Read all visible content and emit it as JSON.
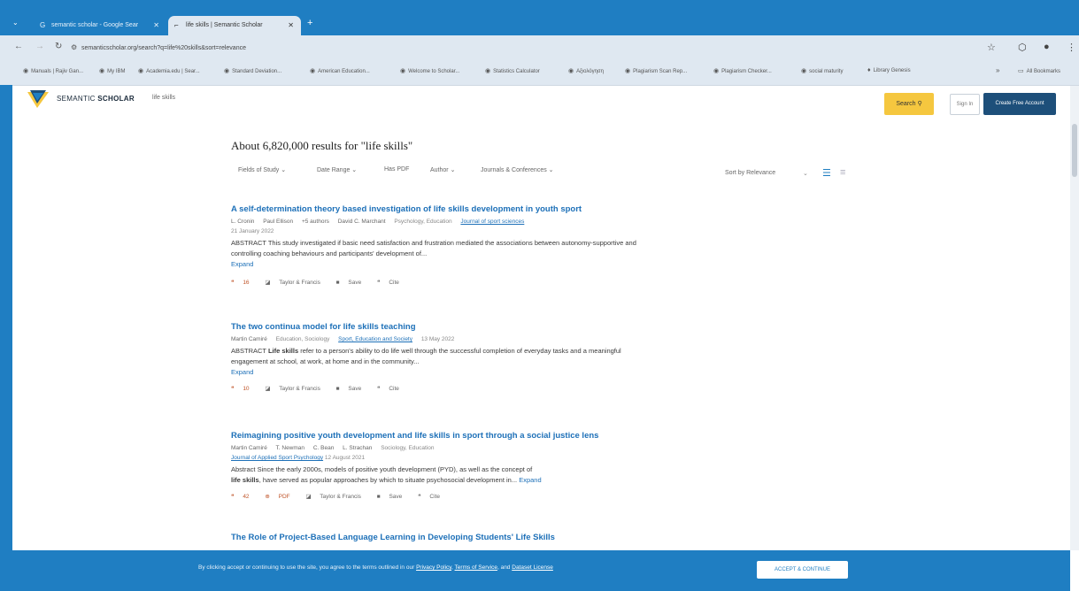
{
  "tabs": [
    {
      "label": "semantic scholar - Google Sear",
      "active": false
    },
    {
      "label": "life skills | Semantic Scholar",
      "active": true
    }
  ],
  "address": {
    "url": "semanticscholar.org/search?q=life%20skills&sort=relevance"
  },
  "bookmarks": [
    "Manuals | Rajiv Gan...",
    "My IBM",
    "Academia.edu | Sear...",
    "Standard Deviation...",
    "American Education...",
    "Welcome to Scholar...",
    "Statistics Calculator",
    "Αξιολόγηση",
    "Plagiarism Scan Rep...",
    "Plagiarism Checker...",
    "social maturity",
    "Library Genesis"
  ],
  "bookmarks_more": "»",
  "bookmarks_all": "All Bookmarks",
  "header": {
    "logo_light": "SEMANTIC",
    "logo_bold": "SCHOLAR",
    "query": "life skills",
    "search_label": "Search",
    "signin_label": "Sign In",
    "create_label": "Create Free Account"
  },
  "results_header": {
    "count_text": "About 6,820,000 results for \"life skills\"",
    "filters": [
      "Fields of Study ⌄",
      "Date Range ⌄",
      "Has PDF",
      "Author ⌄",
      "Journals & Conferences ⌄"
    ],
    "sort_label": "Sort by Relevance",
    "sort_chevron": "⌄"
  },
  "results": [
    {
      "title": "A self-determination theory based investigation of life skills development in youth sport",
      "authors": [
        "L. Cronin",
        "Paul Ellison",
        "+5 authors",
        "David C. Marchant"
      ],
      "fields": "Psychology, Education",
      "journal": "Journal of sport sciences",
      "date": "21 January 2022",
      "abstract_lead": "ABSTRACT",
      "abstract": "This study investigated if basic need satisfaction and frustration mediated the associations between autonomy-supportive and controlling coaching behaviours and participants' development of...",
      "expand": "Expand",
      "citations": "16",
      "publisher": "Taylor & Francis",
      "save": "Save",
      "cite": "Cite"
    },
    {
      "title": "The two continua model for life skills teaching",
      "authors": [
        "Martin Camiré"
      ],
      "fields": "Education, Sociology",
      "journal": "Sport, Education and Society",
      "date": "13 May 2022",
      "abstract_lead": "ABSTRACT",
      "abstract_bold": "Life skills",
      "abstract": "refer to a person's ability to do life well through the successful completion of everyday tasks and a meaningful engagement at school, at work, at home and in the community...",
      "expand": "Expand",
      "citations": "10",
      "publisher": "Taylor & Francis",
      "save": "Save",
      "cite": "Cite"
    },
    {
      "title": "Reimagining positive youth development and life skills in sport through a social justice lens",
      "authors": [
        "Martin Camiré",
        "T. Newman",
        "C. Bean",
        "L. Strachan"
      ],
      "fields": "Sociology, Education",
      "journal": "Journal of Applied Sport Psychology",
      "date": "12 August 2021",
      "abstract_lead": "Abstract",
      "abstract": "Since the early 2000s, models of positive youth development (PYD), as well as the concept of",
      "abstract_bold2": "life skills",
      "abstract2": ", have served as popular approaches by which to situate psychosocial development in...",
      "expand": "Expand",
      "citations": "42",
      "pdf": "PDF",
      "publisher": "Taylor & Francis",
      "save": "Save",
      "cite": "Cite"
    },
    {
      "title": "The Role of Project-Based Language Learning in Developing Students' Life Skills"
    }
  ],
  "cookie": {
    "text": "By clicking accept or continuing to use the site, you agree to the terms outlined in our",
    "privacy": "Privacy Policy",
    "tos": "Terms of Service",
    "and": "and",
    "dataset": "Dataset License",
    "accept_label": "ACCEPT & CONTINUE"
  },
  "colors": {
    "brand_blue": "#1f7ec2",
    "link_blue": "#1d70b8",
    "search_yellow": "#f5c73f",
    "create_navy": "#1d4f7a"
  }
}
